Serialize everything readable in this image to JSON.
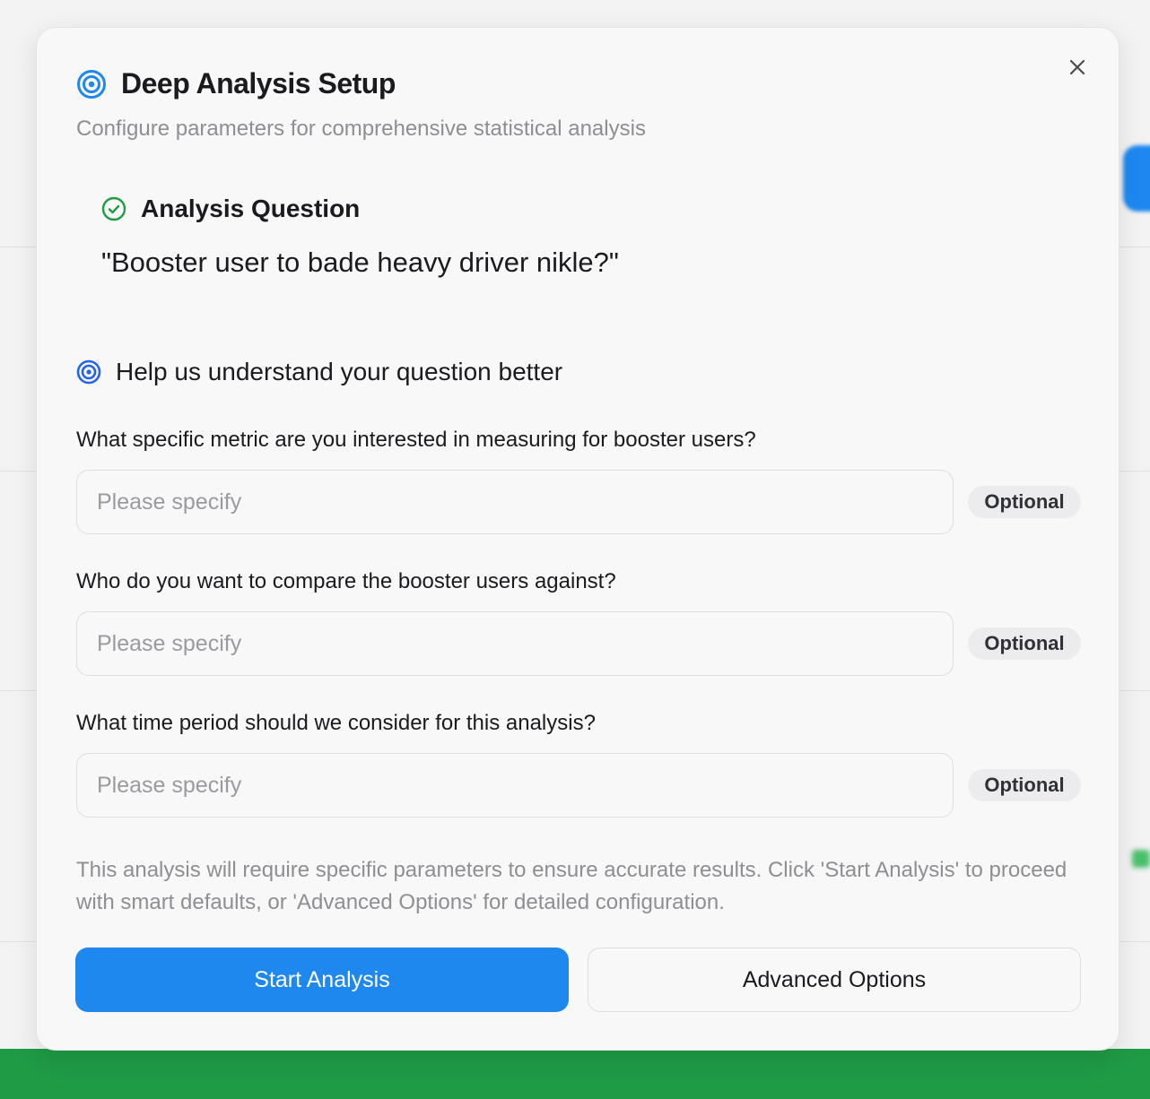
{
  "modal": {
    "title": "Deep Analysis Setup",
    "subtitle": "Configure parameters for comprehensive statistical analysis",
    "title_icon": "target-icon",
    "close_icon": "close-icon"
  },
  "analysis_question": {
    "heading": "Analysis Question",
    "heading_icon": "check-circle-icon",
    "text": "\"Booster user to bade heavy driver nikle?\""
  },
  "clarify": {
    "heading": "Help us understand your question better",
    "heading_icon": "target-icon",
    "questions": [
      {
        "label": "What specific metric are you interested in measuring for booster users?",
        "placeholder": "Please specify",
        "value": "",
        "badge": "Optional"
      },
      {
        "label": "Who do you want to compare the booster users against?",
        "placeholder": "Please specify",
        "value": "",
        "badge": "Optional"
      },
      {
        "label": "What time period should we consider for this analysis?",
        "placeholder": "Please specify",
        "value": "",
        "badge": "Optional"
      }
    ]
  },
  "note": "This analysis will require specific parameters to ensure accurate results. Click 'Start Analysis' to proceed with smart defaults, or 'Advanced Options' for detailed configuration.",
  "actions": {
    "primary": "Start Analysis",
    "secondary": "Advanced Options"
  },
  "colors": {
    "accent": "#1e88ef",
    "success": "#1f9a45",
    "icon_blue": "#2563eb"
  }
}
